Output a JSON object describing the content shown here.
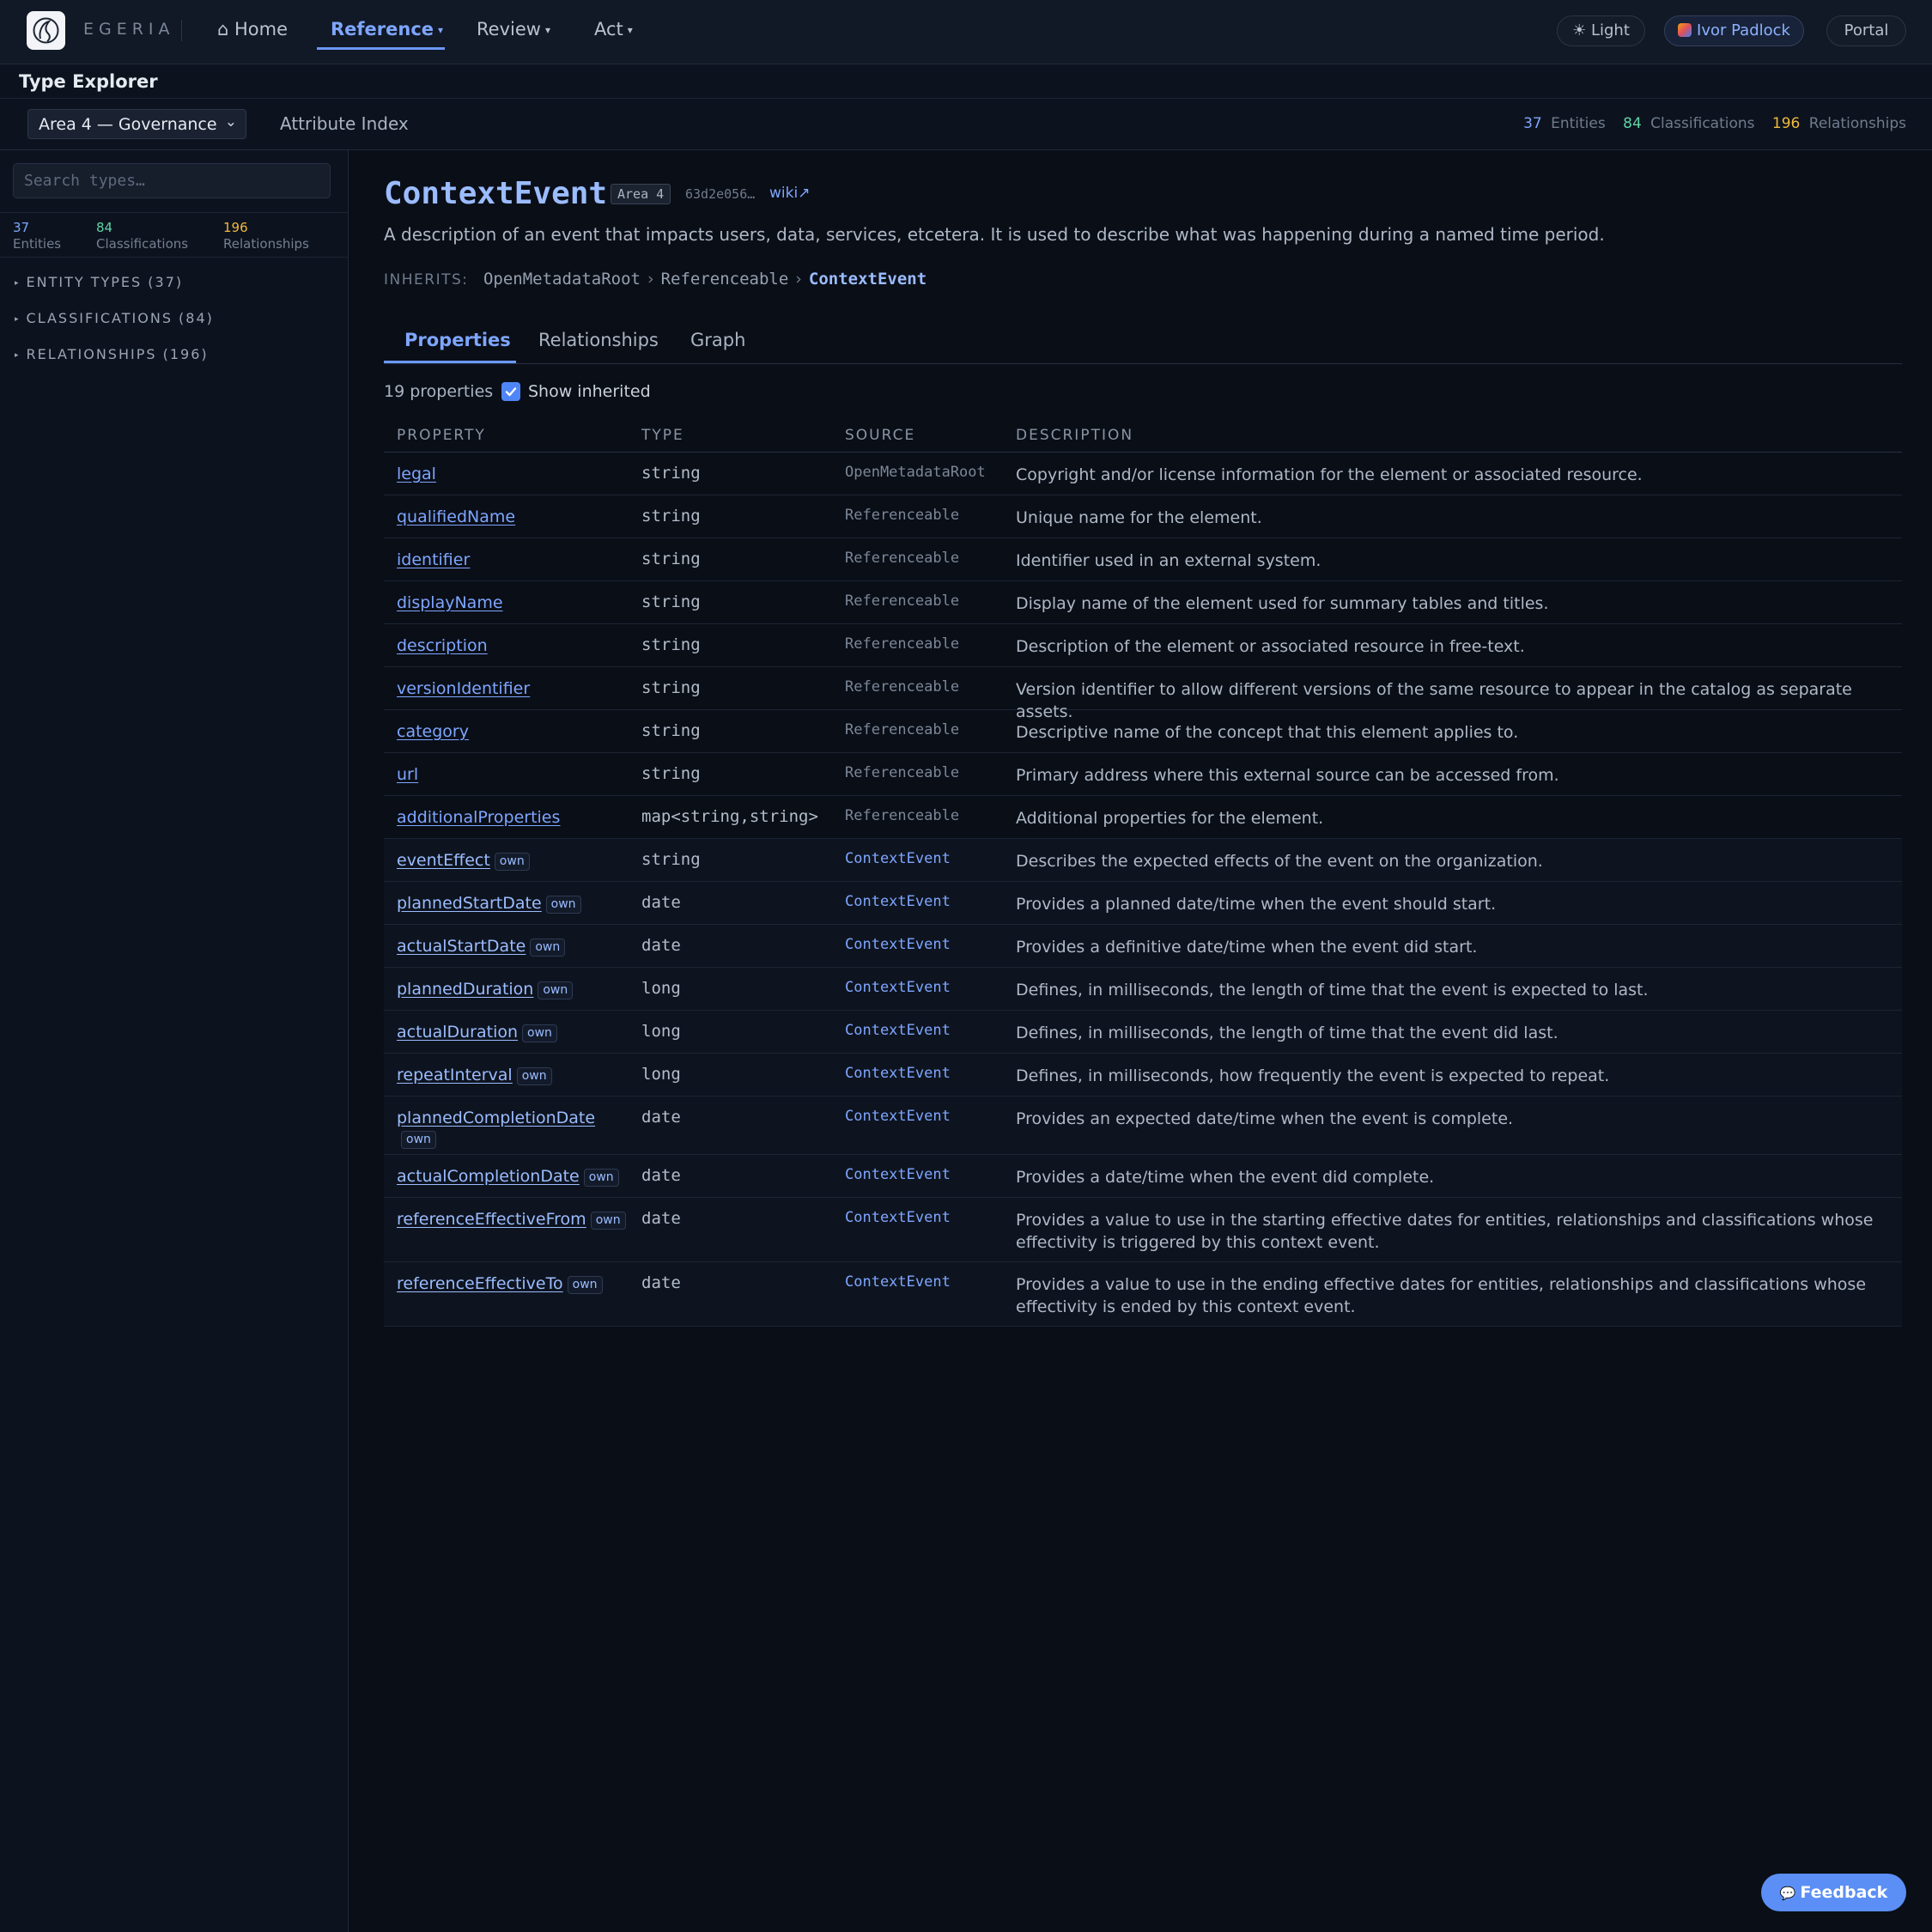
{
  "nav": {
    "brand": "EGERIA",
    "home": "⌂ Home",
    "reference": "Reference",
    "review": "Review",
    "act": "Act",
    "caret": "▾",
    "theme_toggle": "☀ Light",
    "user": "Ivor Padlock",
    "portal": "Portal"
  },
  "header": {
    "title": "Type Explorer",
    "area_select": "Area 4 — Governance",
    "attribute_index": "Attribute Index",
    "stats": {
      "entities_count": "37",
      "entities_label": "Entities",
      "classifications_count": "84",
      "classifications_label": "Classifications",
      "relationships_count": "196",
      "relationships_label": "Relationships"
    }
  },
  "sidebar": {
    "search_placeholder": "Search types…",
    "stats": {
      "entities_count": "37",
      "entities_label": "Entities",
      "classifications_count": "84",
      "classifications_label": "Classifications",
      "relationships_count": "196",
      "relationships_label": "Relationships"
    },
    "sections": [
      "ENTITY TYPES (37)",
      "CLASSIFICATIONS (84)",
      "RELATIONSHIPS (196)"
    ]
  },
  "type": {
    "name": "ContextEvent",
    "area": "Area 4",
    "guid": "63d2e056…",
    "wiki": "wiki↗",
    "description": "A description of an event that impacts users, data, services, etcetera. It is used to describe what was happening during a named time period.",
    "inherits_label": "INHERITS:",
    "inherits": [
      "OpenMetadataRoot",
      "Referenceable"
    ],
    "inherits_sep": "›"
  },
  "tabs": [
    "Properties",
    "Relationships",
    "Graph"
  ],
  "properties": {
    "count_label": "19 properties",
    "show_inherited_label": "Show inherited",
    "show_inherited": true,
    "own_badge": "own",
    "columns": [
      "PROPERTY",
      "TYPE",
      "SOURCE",
      "DESCRIPTION"
    ],
    "rows": [
      {
        "name": "legal",
        "type": "string",
        "source": "OpenMetadataRoot",
        "description": "Copyright and/or license information for the element or associated resource.",
        "own": false
      },
      {
        "name": "qualifiedName",
        "type": "string",
        "source": "Referenceable",
        "description": "Unique name for the element.",
        "own": false
      },
      {
        "name": "identifier",
        "type": "string",
        "source": "Referenceable",
        "description": "Identifier used in an external system.",
        "own": false
      },
      {
        "name": "displayName",
        "type": "string",
        "source": "Referenceable",
        "description": "Display name of the element used for summary tables and titles.",
        "own": false
      },
      {
        "name": "description",
        "type": "string",
        "source": "Referenceable",
        "description": "Description of the element or associated resource in free-text.",
        "own": false
      },
      {
        "name": "versionIdentifier",
        "type": "string",
        "source": "Referenceable",
        "description": "Version identifier to allow different versions of the same resource to appear in the catalog as separate assets.",
        "own": false
      },
      {
        "name": "category",
        "type": "string",
        "source": "Referenceable",
        "description": "Descriptive name of the concept that this element applies to.",
        "own": false
      },
      {
        "name": "url",
        "type": "string",
        "source": "Referenceable",
        "description": "Primary address where this external source can be accessed from.",
        "own": false
      },
      {
        "name": "additionalProperties",
        "type": "map<string,string>",
        "source": "Referenceable",
        "description": "Additional properties for the element.",
        "own": false
      },
      {
        "name": "eventEffect",
        "type": "string",
        "source": "ContextEvent",
        "description": "Describes the expected effects of the event on the organization.",
        "own": true
      },
      {
        "name": "plannedStartDate",
        "type": "date",
        "source": "ContextEvent",
        "description": "Provides a planned date/time when the event should start.",
        "own": true
      },
      {
        "name": "actualStartDate",
        "type": "date",
        "source": "ContextEvent",
        "description": "Provides a definitive date/time when the event did start.",
        "own": true
      },
      {
        "name": "plannedDuration",
        "type": "long",
        "source": "ContextEvent",
        "description": "Defines, in milliseconds, the length of time that the event is expected to last.",
        "own": true
      },
      {
        "name": "actualDuration",
        "type": "long",
        "source": "ContextEvent",
        "description": "Defines, in milliseconds, the length of time that the event did last.",
        "own": true
      },
      {
        "name": "repeatInterval",
        "type": "long",
        "source": "ContextEvent",
        "description": "Defines, in milliseconds, how frequently the event is expected to repeat.",
        "own": true
      },
      {
        "name": "plannedCompletionDate",
        "type": "date",
        "source": "ContextEvent",
        "description": "Provides an expected date/time when the event is complete.",
        "own": true
      },
      {
        "name": "actualCompletionDate",
        "type": "date",
        "source": "ContextEvent",
        "description": "Provides a date/time when the event did complete.",
        "own": true
      },
      {
        "name": "referenceEffectiveFrom",
        "type": "date",
        "source": "ContextEvent",
        "description": "Provides a value to use in the starting effective dates for entities, relationships and classifications whose effectivity is triggered by this context event.",
        "own": true
      },
      {
        "name": "referenceEffectiveTo",
        "type": "date",
        "source": "ContextEvent",
        "description": "Provides a value to use in the ending effective dates for entities, relationships and classifications whose effectivity is ended by this context event.",
        "own": true
      }
    ]
  },
  "feedback": {
    "icon": "💬",
    "label": "Feedback"
  },
  "colors": {
    "accent": "#7ea6ff",
    "entities": "#7ea6ff",
    "classifications": "#5fd4a5",
    "relationships": "#f1b93c",
    "background": "#0a0e17"
  }
}
